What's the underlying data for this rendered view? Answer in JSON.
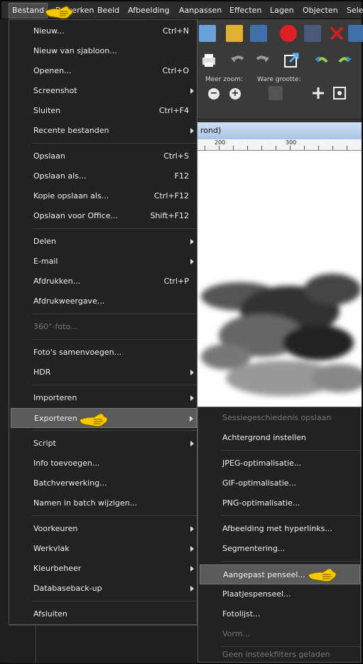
{
  "menubar": {
    "items": [
      "Bestand",
      "Bewerken",
      "Beeld",
      "Afbeelding",
      "Aanpassen",
      "Effecten",
      "Lagen",
      "Objecten",
      "Sele"
    ],
    "active_index": 0
  },
  "toolbar": {
    "zoom_more_label": "Meer zoom:",
    "actual_size_label": "Ware grootte:",
    "zoom_out_icon": "minus-circle-icon",
    "zoom_in_icon": "plus-circle-icon"
  },
  "document": {
    "title_fragment": "rond)",
    "ruler_labels": [
      "200",
      "300"
    ]
  },
  "file_menu": {
    "items": [
      {
        "label": "Nieuw...",
        "shortcut": "Ctrl+N"
      },
      {
        "label": "Nieuw van sjabloon...",
        "shortcut": ""
      },
      {
        "label": "Openen...",
        "shortcut": "Ctrl+O"
      },
      {
        "label": "Screenshot",
        "shortcut": ""
      },
      {
        "label": "Sluiten",
        "shortcut": "Ctrl+F4"
      },
      {
        "label": "Recente bestanden",
        "shortcut": ""
      },
      {
        "label": "Opslaan",
        "shortcut": "Ctrl+S"
      },
      {
        "label": "Opslaan als...",
        "shortcut": "F12"
      },
      {
        "label": "Kopie opslaan als...",
        "shortcut": "Ctrl+F12"
      },
      {
        "label": "Opslaan voor Office...",
        "shortcut": "Shift+F12"
      },
      {
        "label": "Delen",
        "shortcut": ""
      },
      {
        "label": "E-mail",
        "shortcut": ""
      },
      {
        "label": "Afdrukken...",
        "shortcut": "Ctrl+P"
      },
      {
        "label": "Afdrukweergave...",
        "shortcut": ""
      },
      {
        "label": "360°-foto...",
        "shortcut": ""
      },
      {
        "label": "Foto's samenvoegen...",
        "shortcut": ""
      },
      {
        "label": "HDR",
        "shortcut": ""
      },
      {
        "label": "Importeren",
        "shortcut": ""
      },
      {
        "label": "Exporteren",
        "shortcut": ""
      },
      {
        "label": "Script",
        "shortcut": ""
      },
      {
        "label": "Info toevoegen...",
        "shortcut": ""
      },
      {
        "label": "Batchverwerking...",
        "shortcut": ""
      },
      {
        "label": "Namen in batch wijzigen...",
        "shortcut": ""
      },
      {
        "label": "Voorkeuren",
        "shortcut": ""
      },
      {
        "label": "Werkvlak",
        "shortcut": ""
      },
      {
        "label": "Kleurbeheer",
        "shortcut": ""
      },
      {
        "label": "Databaseback-up",
        "shortcut": ""
      },
      {
        "label": "Afsluiten",
        "shortcut": ""
      }
    ]
  },
  "export_submenu": {
    "items": [
      {
        "label": "Sessiegeschiedenis opslaan"
      },
      {
        "label": "Achtergrond instellen"
      },
      {
        "label": "JPEG-optimalisatie..."
      },
      {
        "label": "GIF-optimalisatie..."
      },
      {
        "label": "PNG-optimalisatie..."
      },
      {
        "label": "Afbeelding met hyperlinks..."
      },
      {
        "label": "Segmentering..."
      },
      {
        "label": "Aangepast penseel..."
      },
      {
        "label": "Plaatjespenseel..."
      },
      {
        "label": "Fotolijst..."
      },
      {
        "label": "Vorm..."
      },
      {
        "label": "Geen insteekfilters geladen"
      }
    ]
  },
  "colors": {
    "menu_bg": "#222222",
    "highlight": "#5a5a5a",
    "pointer_hand": "#f5c800"
  }
}
